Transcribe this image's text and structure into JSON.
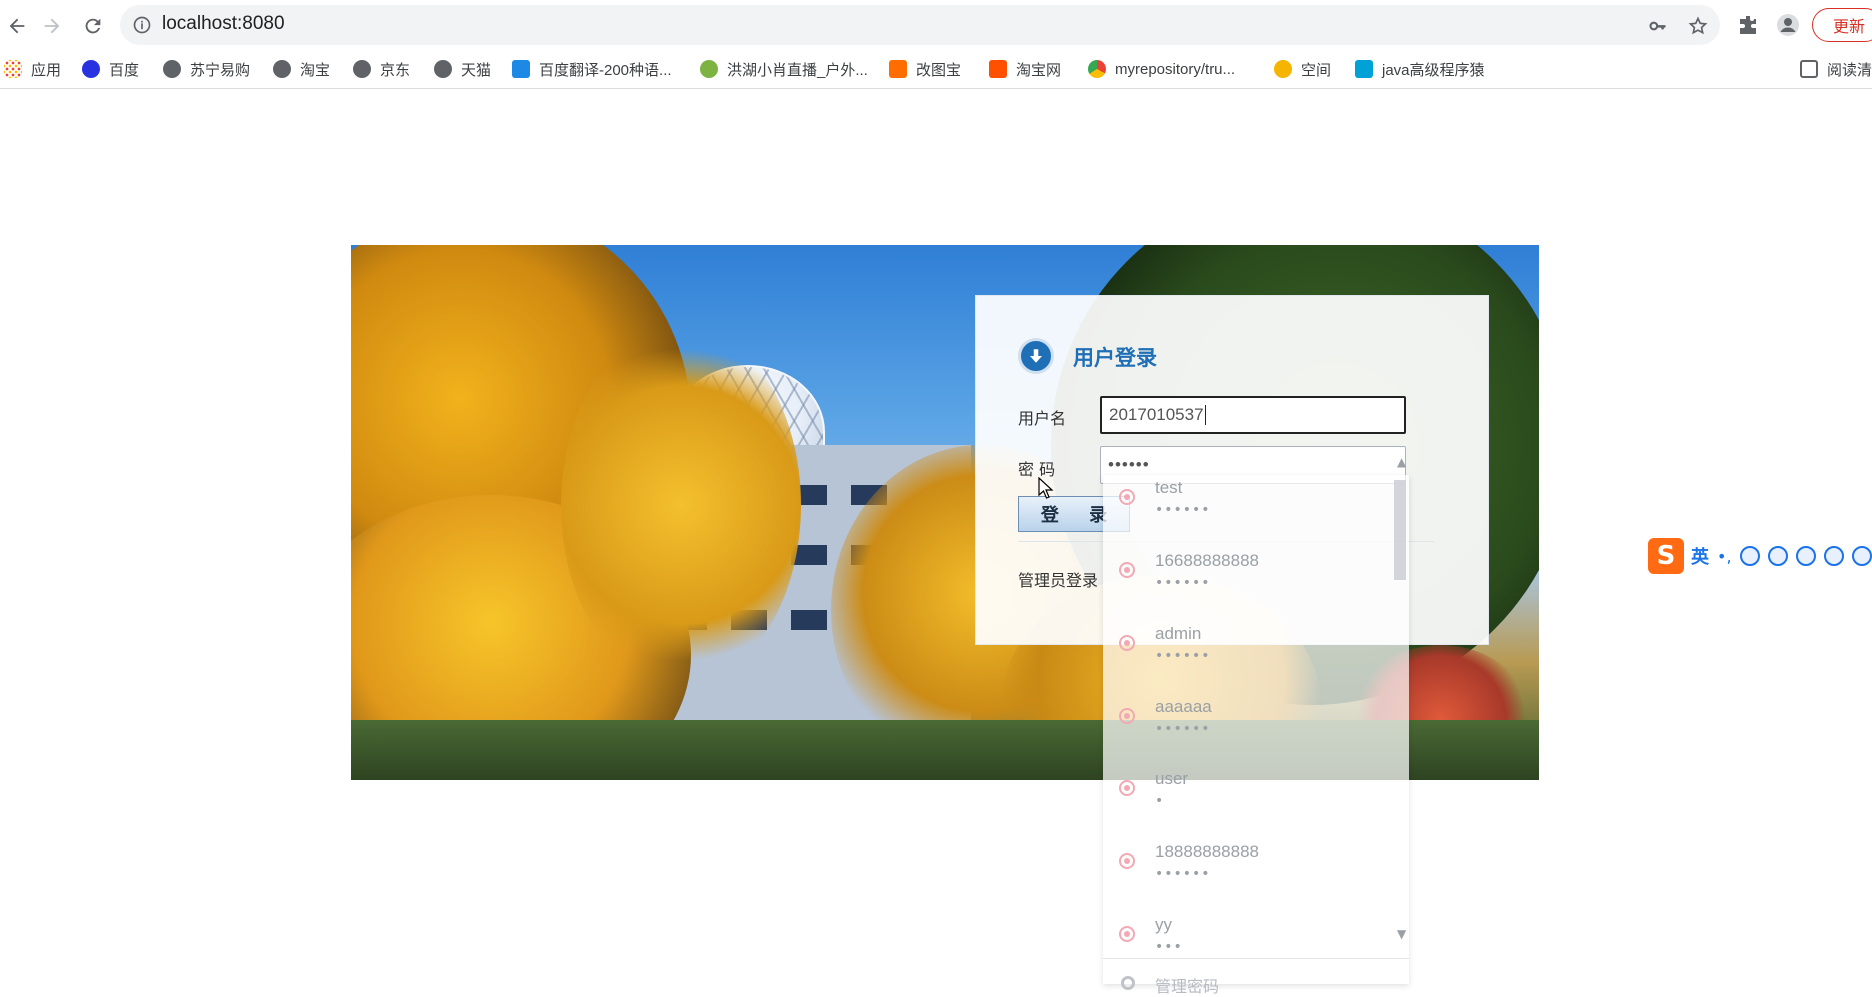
{
  "browser": {
    "url": "localhost:8080",
    "update_label": "更新",
    "reader_label": "阅读清",
    "bookmarks": [
      {
        "label": "应用",
        "icon": "apps-grid-icon",
        "color": "#ea4335"
      },
      {
        "label": "百度",
        "icon": "baidu-paw-icon",
        "color": "#2932e1"
      },
      {
        "label": "苏宁易购",
        "icon": "globe-icon",
        "color": "#5f6368"
      },
      {
        "label": "淘宝",
        "icon": "globe-icon",
        "color": "#5f6368"
      },
      {
        "label": "京东",
        "icon": "globe-icon",
        "color": "#5f6368"
      },
      {
        "label": "天猫",
        "icon": "globe-icon",
        "color": "#5f6368"
      },
      {
        "label": "百度翻译-200种语...",
        "icon": "translate-icon",
        "color": "#1e88e5"
      },
      {
        "label": "洪湖小肖直播_户外...",
        "icon": "live-icon",
        "color": "#7cb342"
      },
      {
        "label": "改图宝",
        "icon": "gaitubao-icon",
        "color": "#ff6d00"
      },
      {
        "label": "淘宝网",
        "icon": "taobao-icon",
        "color": "#ff5000"
      },
      {
        "label": "myrepository/tru...",
        "icon": "chrome-icon",
        "color": "#34a853"
      },
      {
        "label": "空间",
        "icon": "qzone-icon",
        "color": "#f4b400"
      },
      {
        "label": "java高级程序猿",
        "icon": "bilibili-icon",
        "color": "#00a1d6"
      }
    ]
  },
  "login": {
    "title": "用户登录",
    "username_label": "用户名",
    "username_value": "2017010537",
    "password_label": "密 码",
    "password_value": "••••••",
    "submit_label": "登 录",
    "admin_link": "管理员登录"
  },
  "autofill": {
    "items": [
      {
        "username": "test",
        "password": "••••••"
      },
      {
        "username": "16688888888",
        "password": "••••••"
      },
      {
        "username": "admin",
        "password": "••••••"
      },
      {
        "username": "aaaaaa",
        "password": "••••••"
      },
      {
        "username": "user",
        "password": "•"
      },
      {
        "username": "18888888888",
        "password": "••••••"
      },
      {
        "username": "yy",
        "password": "•••"
      }
    ],
    "footer_label": "管理密码"
  },
  "ime": {
    "logo": "S",
    "lang": "英",
    "punct": "•,"
  }
}
